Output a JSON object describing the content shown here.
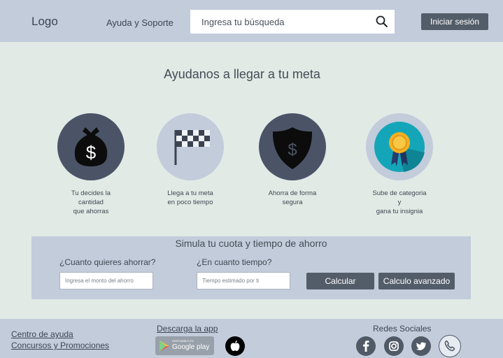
{
  "header": {
    "logo": "Logo",
    "help_link": "Ayuda y Soporte",
    "search_placeholder": "Ingresa tu búsqueda",
    "login_label": "Iniciar sesión"
  },
  "main": {
    "title": "Ayudanos a llegar a tu meta"
  },
  "features": [
    {
      "icon": "money-bag-icon",
      "caption": [
        "Tu decides la",
        "cantidad",
        "que ahorras"
      ]
    },
    {
      "icon": "checkered-flag-icon",
      "caption": [
        "Llega a tu meta",
        "en poco tiempo"
      ]
    },
    {
      "icon": "shield-dollar-icon",
      "caption": [
        "Ahorra de forma",
        "segura"
      ]
    },
    {
      "icon": "medal-badge-icon",
      "caption": [
        "Sube de categoria",
        "y",
        "gana tu insignia"
      ]
    }
  ],
  "simulator": {
    "title": "Simula tu cuota y tiempo de ahorro",
    "amount_label": "¿Cuanto quieres ahorrar?",
    "amount_placeholder": "Ingresa el monto del ahorro",
    "time_label": "¿En cuanto tiempo?",
    "time_placeholder": "Tiempo estimado por ti",
    "calc_label": "Calcular",
    "advanced_label": "Calculo avanzado"
  },
  "footer": {
    "help_center": "Centro de ayuda",
    "contests": "Concursos y Promociones",
    "app_title": "Descarga la app",
    "gplay_small": "DISPONIBLE EN",
    "gplay_label": "Google play",
    "social_title": "Redes Sociales",
    "social_icons": [
      "facebook-icon",
      "instagram-icon",
      "twitter-icon",
      "phone-icon"
    ]
  },
  "colors": {
    "header_bg": "#c2ccdb",
    "page_bg": "#e2eae6",
    "button_bg": "#535d69",
    "circle_dark": "#4b5467",
    "circle_light": "#c2ccdb",
    "medal_teal": "#14a6b8",
    "medal_gold": "#f5b120"
  }
}
